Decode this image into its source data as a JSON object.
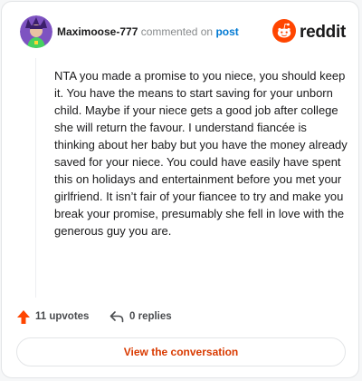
{
  "comment": {
    "username": "Maximoose-777",
    "action_text": "commented on",
    "post_link": "post",
    "body": "NTA you made a promise to you niece, you should keep it. You have the means to start saving for your unborn child. Maybe if your niece gets a good job after college she will return the favour. I understand fiancée is thinking about her baby but you have the money already saved for your niece. You could have easily have spent this on holidays and entertainment before you met your girlfriend. It isn’t fair of your fiancee to try and make you break your promise, presumably she fell in love with the generous guy you are.",
    "upvotes": "11 upvotes",
    "replies": "0 replies"
  },
  "brand": {
    "logo_text": "reddit",
    "accent_color": "#ff4500"
  },
  "cta": {
    "label": "View the conversation"
  },
  "icons": [
    "user-avatar",
    "reddit-alien-icon",
    "upvote-arrow-icon",
    "reply-arrow-icon"
  ]
}
